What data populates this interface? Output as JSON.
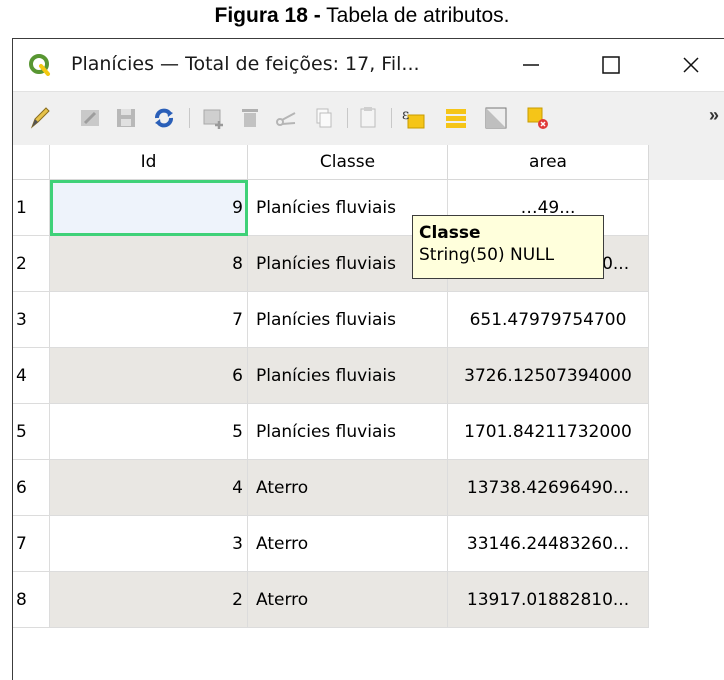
{
  "caption": {
    "prefix": "Figura 18 -",
    "text": " Tabela de atributos."
  },
  "window": {
    "title": "Planícies — Total de feições: 17, Fil...",
    "controls": {
      "minimize": "—",
      "maximize": "☐",
      "close": "✕"
    }
  },
  "toolbar": {
    "icons": [
      "pencil-icon",
      "multi-edit-icon",
      "save-edits-icon",
      "reload-icon",
      "add-feature-icon",
      "delete-feature-icon",
      "cut-icon",
      "copy-icon",
      "paste-icon",
      "expression-select-icon",
      "select-all-icon",
      "invert-selection-icon",
      "deselect-all-icon"
    ],
    "more": "»"
  },
  "table": {
    "columns": [
      "Id",
      "Classe",
      "area"
    ],
    "rows": [
      {
        "num": "1",
        "id": "9",
        "classe": "Planícies fluviais",
        "area": "…49..."
      },
      {
        "num": "2",
        "id": "8",
        "classe": "Planícies fluviais",
        "area": "17075.68680150..."
      },
      {
        "num": "3",
        "id": "7",
        "classe": "Planícies fluviais",
        "area": "651.47979754700"
      },
      {
        "num": "4",
        "id": "6",
        "classe": "Planícies fluviais",
        "area": "3726.12507394000"
      },
      {
        "num": "5",
        "id": "5",
        "classe": "Planícies fluviais",
        "area": "1701.84211732000"
      },
      {
        "num": "6",
        "id": "4",
        "classe": "Aterro",
        "area": "13738.42696490..."
      },
      {
        "num": "7",
        "id": "3",
        "classe": "Aterro",
        "area": "33146.24483260..."
      },
      {
        "num": "8",
        "id": "2",
        "classe": "Aterro",
        "area": "13917.01882810..."
      }
    ]
  },
  "tooltip": {
    "title": "Classe",
    "body": "String(50) NULL"
  },
  "colors": {
    "selection": "#3fd178",
    "alt_row": "#e9e7e3",
    "tooltip_bg": "#ffffdc",
    "qgis_green": "#589632"
  }
}
